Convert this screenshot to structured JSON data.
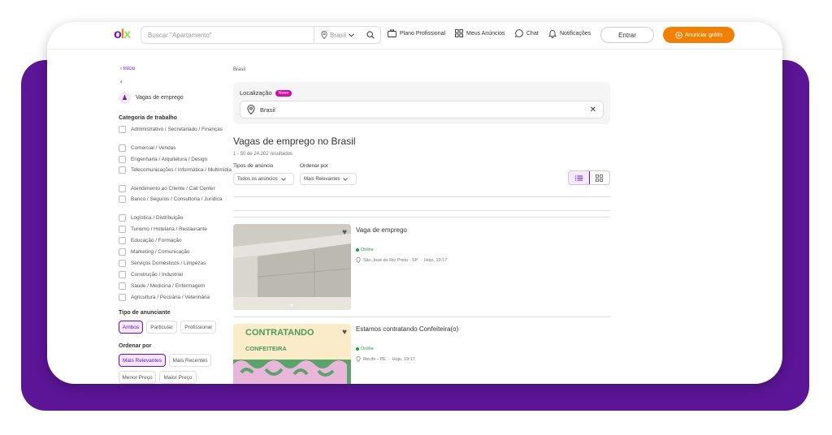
{
  "header": {
    "logo": {
      "o": "o",
      "l": "l",
      "x": "x"
    },
    "search_placeholder": "Buscar \"Apartamento\"",
    "search_location": "Brasil",
    "nav": [
      {
        "label": "Plano Profissional",
        "icon": "briefcase-icon"
      },
      {
        "label": "Meus Anúncios",
        "icon": "grid-icon"
      },
      {
        "label": "Chat",
        "icon": "chat-icon"
      },
      {
        "label": "Notificações",
        "icon": "bell-icon"
      }
    ],
    "login_label": "Entrar",
    "post_label": "Anunciar grátis"
  },
  "sidebar": {
    "home_link": "Início",
    "category": "Vagas de emprego",
    "work_category_title": "Categoria de trabalho",
    "work_categories": [
      "Administrativo / Secretariado / Finanças",
      "Comercial / Vendas",
      "Engenharia / Arquitetura / Design",
      "Telecomunicações / Informática / Multimídia",
      "Atendimento ao Cliente / Call Center",
      "Banco / Seguros / Consultoria / Jurídica",
      "Logística / Distribuição",
      "Turismo / Hotelaria / Restaurante",
      "Educação / Formação",
      "Marketing / Comunicação",
      "Serviços Domésticos / Limpezas",
      "Construção / Industrial",
      "Saúde / Medicina / Enfermagem",
      "Agricultura / Pecuária / Veterinária"
    ],
    "advertiser_title": "Tipo de anunciante",
    "advertiser_options": [
      "Ambos",
      "Particular",
      "Profissional"
    ],
    "order_title": "Ordenar por",
    "order_options": [
      "Mais Relevantes",
      "Mais Recentes",
      "Menor Preço",
      "Maior Preço"
    ]
  },
  "main": {
    "breadcrumb": "Brasil",
    "location_label": "Localização",
    "new_badge": "Novo",
    "location_value": "Brasil",
    "title": "Vagas de emprego no Brasil",
    "results": "1 - 50 de 24.202 resultados",
    "ad_type_label": "Tipos de anúncio",
    "ad_type_value": "Todos os anúncios",
    "sort_label": "Ordenar por",
    "sort_value": "Mais Relevantes",
    "listings": [
      {
        "title": "Vaga de emprego",
        "status": "Online",
        "location": "São José do Rio Preto - SP",
        "date": "Hoje, 19:17"
      },
      {
        "title": "Estamos contratando Confeiteira(o)",
        "status": "Online",
        "location": "Recife - PE",
        "date": "Hoje, 19:17",
        "image_text_1": "CONTRATANDO",
        "image_text_2": "CONFEITEIRA"
      }
    ]
  },
  "colors": {
    "brand_purple": "#6e0ad6",
    "brand_orange": "#f28000",
    "frame_purple": "#5b1596",
    "online_green": "#1f9d3a"
  }
}
